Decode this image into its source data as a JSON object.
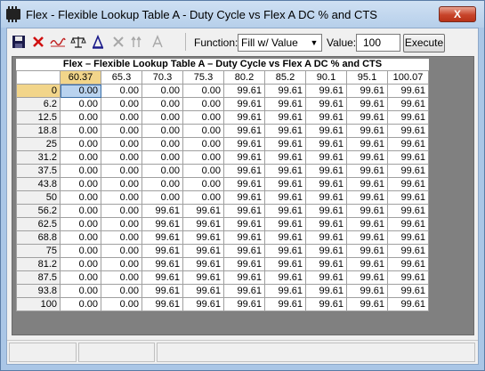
{
  "window": {
    "title": "Flex - Flexible Lookup Table A - Duty Cycle vs Flex A DC % and CTS",
    "close_label": "X"
  },
  "toolbar": {
    "function_label": "Function:",
    "function_value": "Fill w/ Value",
    "value_label": "Value:",
    "value_input": "100",
    "execute_label": "Execute",
    "icons": [
      "save-icon",
      "delete-icon",
      "graph-icon",
      "balance-icon",
      "sigma-icon",
      "x-disabled-icon",
      "up-arrows-disabled-icon",
      "a-disabled-icon"
    ]
  },
  "table": {
    "caption": "Flex – Flexible Lookup Table A – Duty Cycle vs Flex A DC % and CTS",
    "columns": [
      "60.37",
      "65.3",
      "70.3",
      "75.3",
      "80.2",
      "85.2",
      "90.1",
      "95.1",
      "100.07"
    ],
    "rows": [
      {
        "label": "0",
        "values": [
          "0.00",
          "0.00",
          "0.00",
          "0.00",
          "99.61",
          "99.61",
          "99.61",
          "99.61",
          "99.61"
        ]
      },
      {
        "label": "6.2",
        "values": [
          "0.00",
          "0.00",
          "0.00",
          "0.00",
          "99.61",
          "99.61",
          "99.61",
          "99.61",
          "99.61"
        ]
      },
      {
        "label": "12.5",
        "values": [
          "0.00",
          "0.00",
          "0.00",
          "0.00",
          "99.61",
          "99.61",
          "99.61",
          "99.61",
          "99.61"
        ]
      },
      {
        "label": "18.8",
        "values": [
          "0.00",
          "0.00",
          "0.00",
          "0.00",
          "99.61",
          "99.61",
          "99.61",
          "99.61",
          "99.61"
        ]
      },
      {
        "label": "25",
        "values": [
          "0.00",
          "0.00",
          "0.00",
          "0.00",
          "99.61",
          "99.61",
          "99.61",
          "99.61",
          "99.61"
        ]
      },
      {
        "label": "31.2",
        "values": [
          "0.00",
          "0.00",
          "0.00",
          "0.00",
          "99.61",
          "99.61",
          "99.61",
          "99.61",
          "99.61"
        ]
      },
      {
        "label": "37.5",
        "values": [
          "0.00",
          "0.00",
          "0.00",
          "0.00",
          "99.61",
          "99.61",
          "99.61",
          "99.61",
          "99.61"
        ]
      },
      {
        "label": "43.8",
        "values": [
          "0.00",
          "0.00",
          "0.00",
          "0.00",
          "99.61",
          "99.61",
          "99.61",
          "99.61",
          "99.61"
        ]
      },
      {
        "label": "50",
        "values": [
          "0.00",
          "0.00",
          "0.00",
          "0.00",
          "99.61",
          "99.61",
          "99.61",
          "99.61",
          "99.61"
        ]
      },
      {
        "label": "56.2",
        "values": [
          "0.00",
          "0.00",
          "99.61",
          "99.61",
          "99.61",
          "99.61",
          "99.61",
          "99.61",
          "99.61"
        ]
      },
      {
        "label": "62.5",
        "values": [
          "0.00",
          "0.00",
          "99.61",
          "99.61",
          "99.61",
          "99.61",
          "99.61",
          "99.61",
          "99.61"
        ]
      },
      {
        "label": "68.8",
        "values": [
          "0.00",
          "0.00",
          "99.61",
          "99.61",
          "99.61",
          "99.61",
          "99.61",
          "99.61",
          "99.61"
        ]
      },
      {
        "label": "75",
        "values": [
          "0.00",
          "0.00",
          "99.61",
          "99.61",
          "99.61",
          "99.61",
          "99.61",
          "99.61",
          "99.61"
        ]
      },
      {
        "label": "81.2",
        "values": [
          "0.00",
          "0.00",
          "99.61",
          "99.61",
          "99.61",
          "99.61",
          "99.61",
          "99.61",
          "99.61"
        ]
      },
      {
        "label": "87.5",
        "values": [
          "0.00",
          "0.00",
          "99.61",
          "99.61",
          "99.61",
          "99.61",
          "99.61",
          "99.61",
          "99.61"
        ]
      },
      {
        "label": "93.8",
        "values": [
          "0.00",
          "0.00",
          "99.61",
          "99.61",
          "99.61",
          "99.61",
          "99.61",
          "99.61",
          "99.61"
        ]
      },
      {
        "label": "100",
        "values": [
          "0.00",
          "0.00",
          "99.61",
          "99.61",
          "99.61",
          "99.61",
          "99.61",
          "99.61",
          "99.61"
        ]
      }
    ]
  },
  "colors": {
    "active_header": "#f2d58a",
    "selected_cell": "#b9d3ef"
  }
}
